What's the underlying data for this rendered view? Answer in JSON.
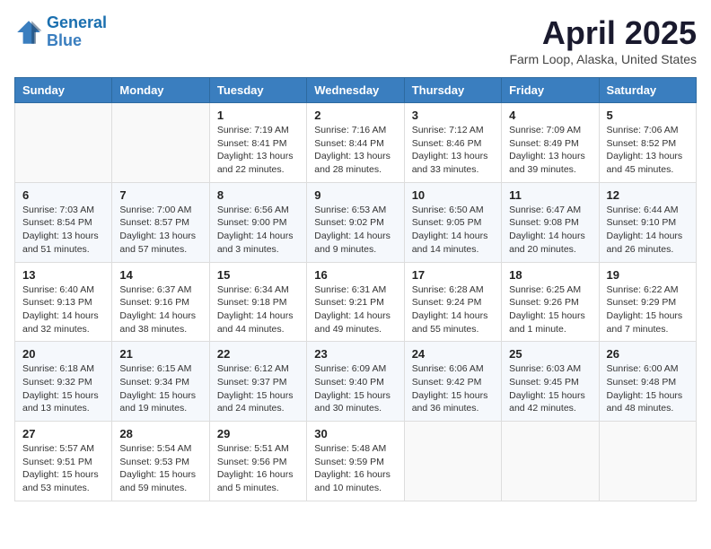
{
  "logo": {
    "line1": "General",
    "line2": "Blue"
  },
  "title": "April 2025",
  "subtitle": "Farm Loop, Alaska, United States",
  "days_of_week": [
    "Sunday",
    "Monday",
    "Tuesday",
    "Wednesday",
    "Thursday",
    "Friday",
    "Saturday"
  ],
  "weeks": [
    [
      {
        "day": "",
        "info": ""
      },
      {
        "day": "",
        "info": ""
      },
      {
        "day": "1",
        "info": "Sunrise: 7:19 AM\nSunset: 8:41 PM\nDaylight: 13 hours\nand 22 minutes."
      },
      {
        "day": "2",
        "info": "Sunrise: 7:16 AM\nSunset: 8:44 PM\nDaylight: 13 hours\nand 28 minutes."
      },
      {
        "day": "3",
        "info": "Sunrise: 7:12 AM\nSunset: 8:46 PM\nDaylight: 13 hours\nand 33 minutes."
      },
      {
        "day": "4",
        "info": "Sunrise: 7:09 AM\nSunset: 8:49 PM\nDaylight: 13 hours\nand 39 minutes."
      },
      {
        "day": "5",
        "info": "Sunrise: 7:06 AM\nSunset: 8:52 PM\nDaylight: 13 hours\nand 45 minutes."
      }
    ],
    [
      {
        "day": "6",
        "info": "Sunrise: 7:03 AM\nSunset: 8:54 PM\nDaylight: 13 hours\nand 51 minutes."
      },
      {
        "day": "7",
        "info": "Sunrise: 7:00 AM\nSunset: 8:57 PM\nDaylight: 13 hours\nand 57 minutes."
      },
      {
        "day": "8",
        "info": "Sunrise: 6:56 AM\nSunset: 9:00 PM\nDaylight: 14 hours\nand 3 minutes."
      },
      {
        "day": "9",
        "info": "Sunrise: 6:53 AM\nSunset: 9:02 PM\nDaylight: 14 hours\nand 9 minutes."
      },
      {
        "day": "10",
        "info": "Sunrise: 6:50 AM\nSunset: 9:05 PM\nDaylight: 14 hours\nand 14 minutes."
      },
      {
        "day": "11",
        "info": "Sunrise: 6:47 AM\nSunset: 9:08 PM\nDaylight: 14 hours\nand 20 minutes."
      },
      {
        "day": "12",
        "info": "Sunrise: 6:44 AM\nSunset: 9:10 PM\nDaylight: 14 hours\nand 26 minutes."
      }
    ],
    [
      {
        "day": "13",
        "info": "Sunrise: 6:40 AM\nSunset: 9:13 PM\nDaylight: 14 hours\nand 32 minutes."
      },
      {
        "day": "14",
        "info": "Sunrise: 6:37 AM\nSunset: 9:16 PM\nDaylight: 14 hours\nand 38 minutes."
      },
      {
        "day": "15",
        "info": "Sunrise: 6:34 AM\nSunset: 9:18 PM\nDaylight: 14 hours\nand 44 minutes."
      },
      {
        "day": "16",
        "info": "Sunrise: 6:31 AM\nSunset: 9:21 PM\nDaylight: 14 hours\nand 49 minutes."
      },
      {
        "day": "17",
        "info": "Sunrise: 6:28 AM\nSunset: 9:24 PM\nDaylight: 14 hours\nand 55 minutes."
      },
      {
        "day": "18",
        "info": "Sunrise: 6:25 AM\nSunset: 9:26 PM\nDaylight: 15 hours\nand 1 minute."
      },
      {
        "day": "19",
        "info": "Sunrise: 6:22 AM\nSunset: 9:29 PM\nDaylight: 15 hours\nand 7 minutes."
      }
    ],
    [
      {
        "day": "20",
        "info": "Sunrise: 6:18 AM\nSunset: 9:32 PM\nDaylight: 15 hours\nand 13 minutes."
      },
      {
        "day": "21",
        "info": "Sunrise: 6:15 AM\nSunset: 9:34 PM\nDaylight: 15 hours\nand 19 minutes."
      },
      {
        "day": "22",
        "info": "Sunrise: 6:12 AM\nSunset: 9:37 PM\nDaylight: 15 hours\nand 24 minutes."
      },
      {
        "day": "23",
        "info": "Sunrise: 6:09 AM\nSunset: 9:40 PM\nDaylight: 15 hours\nand 30 minutes."
      },
      {
        "day": "24",
        "info": "Sunrise: 6:06 AM\nSunset: 9:42 PM\nDaylight: 15 hours\nand 36 minutes."
      },
      {
        "day": "25",
        "info": "Sunrise: 6:03 AM\nSunset: 9:45 PM\nDaylight: 15 hours\nand 42 minutes."
      },
      {
        "day": "26",
        "info": "Sunrise: 6:00 AM\nSunset: 9:48 PM\nDaylight: 15 hours\nand 48 minutes."
      }
    ],
    [
      {
        "day": "27",
        "info": "Sunrise: 5:57 AM\nSunset: 9:51 PM\nDaylight: 15 hours\nand 53 minutes."
      },
      {
        "day": "28",
        "info": "Sunrise: 5:54 AM\nSunset: 9:53 PM\nDaylight: 15 hours\nand 59 minutes."
      },
      {
        "day": "29",
        "info": "Sunrise: 5:51 AM\nSunset: 9:56 PM\nDaylight: 16 hours\nand 5 minutes."
      },
      {
        "day": "30",
        "info": "Sunrise: 5:48 AM\nSunset: 9:59 PM\nDaylight: 16 hours\nand 10 minutes."
      },
      {
        "day": "",
        "info": ""
      },
      {
        "day": "",
        "info": ""
      },
      {
        "day": "",
        "info": ""
      }
    ]
  ]
}
